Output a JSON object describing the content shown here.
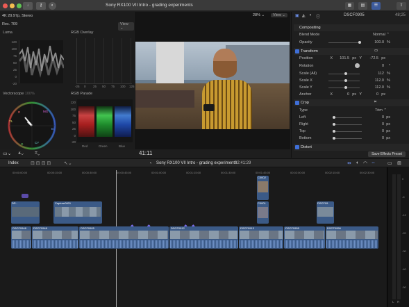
{
  "window": {
    "title": "Sony RX100 VII Intro - grading experiments"
  },
  "viewer": {
    "format": "4K 29.97p, Stereo",
    "zoom": "28%",
    "view_label": "View",
    "timecode": "41:11"
  },
  "scopes": {
    "mode": "Rec. 709",
    "view_label": "View",
    "luma": {
      "title": "Luma",
      "ticks": [
        "120",
        "100",
        "75",
        "50",
        "25",
        "0",
        "-20"
      ]
    },
    "rgb_overlay": {
      "title": "RGB Overlay",
      "xticks": [
        "-25",
        "0",
        "25",
        "50",
        "75",
        "100",
        "125"
      ]
    },
    "vectorscope": {
      "title": "Vectorscope",
      "suffix": "100%",
      "labels": [
        "R",
        "MG",
        "B",
        "CY",
        "G",
        "YL"
      ]
    },
    "rgb_parade": {
      "title": "RGB Parade",
      "ticks": [
        "120",
        "100",
        "75",
        "50",
        "25",
        "0",
        "-20"
      ],
      "channels": [
        "Red",
        "Green",
        "Blue"
      ]
    }
  },
  "inspector": {
    "clip_name": "DSCF0905",
    "duration": "48;25",
    "section_compositing": "Compositing",
    "blend_mode": {
      "label": "Blend Mode",
      "value": "Normal"
    },
    "opacity": {
      "label": "Opacity",
      "value": "100.0",
      "unit": "%",
      "fraction": 1.0
    },
    "section_transform": "Transform",
    "position": {
      "label": "Position",
      "x_label": "X",
      "x": "101.5",
      "y_label": "Y",
      "y": "-72.5",
      "unit": "px"
    },
    "rotation": {
      "label": "Rotation",
      "value": "0",
      "unit": "°"
    },
    "scale_all": {
      "label": "Scale (All)",
      "value": "112",
      "unit": "%",
      "fraction": 0.56
    },
    "scale_x": {
      "label": "Scale X",
      "value": "112.0",
      "unit": "%",
      "fraction": 0.56
    },
    "scale_y": {
      "label": "Scale Y",
      "value": "112.0",
      "unit": "%",
      "fraction": 0.56
    },
    "anchor": {
      "label": "Anchor",
      "x_label": "X",
      "x": "0",
      "y_label": "Y",
      "y": "0",
      "unit": "px"
    },
    "section_crop": "Crop",
    "crop_type": {
      "label": "Type",
      "value": "Trim"
    },
    "crop_left": {
      "label": "Left",
      "value": "0",
      "unit": "px",
      "fraction": 0.0
    },
    "crop_right": {
      "label": "Right",
      "value": "0",
      "unit": "px",
      "fraction": 0.0
    },
    "crop_top": {
      "label": "Top",
      "value": "0",
      "unit": "px",
      "fraction": 0.0
    },
    "crop_bottom": {
      "label": "Bottom",
      "value": "0",
      "unit": "px",
      "fraction": 0.0
    },
    "section_distort": "Distort",
    "save_preset": "Save Effects Preset"
  },
  "timeline": {
    "index_label": "Index",
    "project": "Sony RX100 VII Intro - grading experiments",
    "duration": "02:41:29",
    "ruler": [
      "00:00:00:00",
      "00:00:15:00",
      "00:00:30:00",
      "00:00:45:00",
      "00:01:00:00",
      "00:01:15:00",
      "00:01:30:00",
      "00:01:45:00",
      "00:02:00:00",
      "00:02:15:00",
      "00:02:30:00"
    ],
    "connected_clips": [
      {
        "name": "C0002"
      },
      {
        "name": "C0001"
      },
      {
        "name": "DP..."
      },
      {
        "name": "Capture0001"
      },
      {
        "name": "DSCF09"
      }
    ],
    "primary_clips": [
      "DSCF0948",
      "DSCF0948",
      "DSCF0905",
      "DSCF0912",
      "DSCF0913",
      "DSCF0955",
      "DSCF0956"
    ],
    "meter_labels": [
      "0",
      "-6",
      "-12",
      "-20",
      "-30",
      "-40",
      "-50"
    ],
    "meter_channels": [
      "L",
      "R"
    ]
  },
  "colors": {
    "accent": "#3f6fd8",
    "selection": "#5a4fc8",
    "clip_blue": "#3b5a87",
    "clip_purple": "#5b4ba8"
  }
}
